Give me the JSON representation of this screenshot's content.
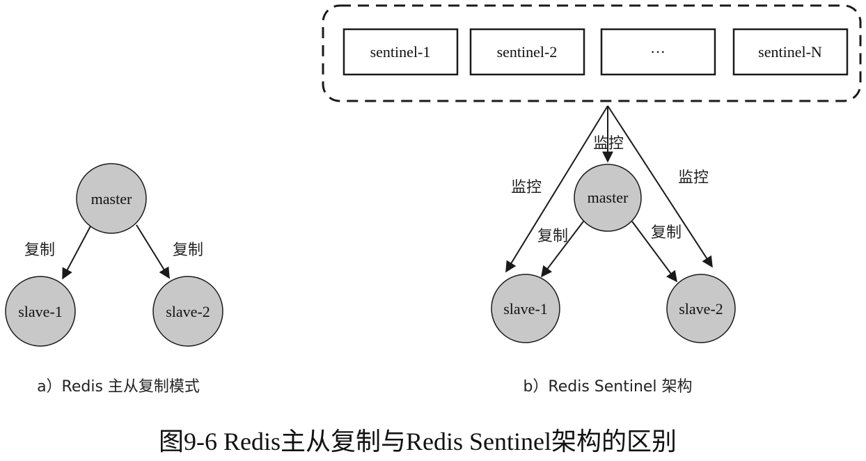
{
  "figure_caption": "图9-6 Redis主从复制与Redis Sentinel架构的区别",
  "colors": {
    "node_fill": "#c8c8c8",
    "stroke": "#1a1a1a",
    "background": "#ffffff"
  },
  "panel_a": {
    "caption": "a）Redis 主从复制模式",
    "master": "master",
    "slaves": [
      "slave-1",
      "slave-2"
    ],
    "edge_labels": [
      "复制",
      "复制"
    ]
  },
  "panel_b": {
    "caption": "b）Redis Sentinel 架构",
    "sentinels": [
      "sentinel-1",
      "sentinel-2",
      "···",
      "sentinel-N"
    ],
    "master": "master",
    "slaves": [
      "slave-1",
      "slave-2"
    ],
    "monitor_labels": [
      "监控",
      "监控",
      "监控"
    ],
    "replicate_labels": [
      "复制",
      "复制"
    ]
  }
}
